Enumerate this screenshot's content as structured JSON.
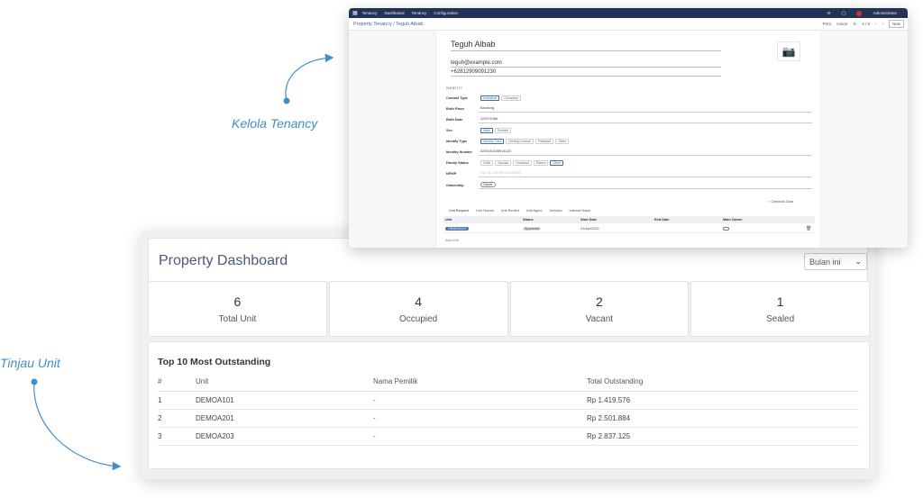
{
  "annotations": {
    "tenancy": "Kelola Tenancy",
    "unit": "Tinjau Unit"
  },
  "colors": {
    "accent": "#3f8fca",
    "navbar": "#24325a",
    "unit_badge": "#4d74a8"
  },
  "tenancy_window": {
    "navbar": {
      "apps_icon": "grid-icon",
      "items": [
        "Tenancy",
        "Dashboard",
        "Tenancy",
        "Configuration"
      ],
      "user": "Administrator"
    },
    "breadcrumb": "Property Tenancy / Teguh Albab",
    "toolbar": {
      "print": "Print",
      "action": "Action",
      "pager": "4 / 5",
      "new": "New"
    },
    "contact": {
      "name": "Teguh Albab",
      "email": "teguh@example.com",
      "phone": "+62812909091230"
    },
    "section_label": "IDENTITY",
    "fields": {
      "contact_type": {
        "label": "Contact Type",
        "options": [
          "Individual",
          "Company"
        ],
        "selected": "Individual"
      },
      "birth_place": {
        "label": "Birth Place",
        "value": "Bandung"
      },
      "birth_date": {
        "label": "Birth Date",
        "value": "22/02/1988"
      },
      "sex": {
        "label": "Sex",
        "options": [
          "Male",
          "Female"
        ],
        "selected": "Male"
      },
      "identity_type": {
        "label": "Identity Type",
        "options": [
          "Identity Card",
          "Driving License",
          "Passport",
          "Other"
        ],
        "selected": "Identity Card"
      },
      "identity_number": {
        "label": "Identity Number",
        "value": "3209182038914023"
      },
      "family_status": {
        "label": "Family Status",
        "options": [
          "Child",
          "Spouse",
          "Husband",
          "Parent",
          "Other"
        ],
        "selected": "Other"
      },
      "npwp": {
        "label": "NPWP",
        "placeholder": "e.g. 01.234.567.8-012.345"
      },
      "ownership": {
        "label": "Ownership",
        "value": "Owner"
      }
    },
    "optional_data": "Optional Data",
    "tabs": [
      "Unit Request",
      "Unit Owned",
      "Unit Rented",
      "Unit Agent",
      "Vehicles",
      "Internal Notes"
    ],
    "lines": {
      "headers": [
        "Unit",
        "Status",
        "Start Date",
        "End Date",
        "Main Owner"
      ],
      "rows": [
        {
          "unit": "DEMOA101",
          "status": "Approved",
          "start_date": "01/Apr/2022",
          "end_date": ""
        }
      ],
      "add_line": "Add Unit"
    }
  },
  "dashboard": {
    "title": "Property Dashboard",
    "period_select": "Bulan ini",
    "stats": [
      {
        "value": "6",
        "label": "Total Unit"
      },
      {
        "value": "4",
        "label": "Occupied"
      },
      {
        "value": "2",
        "label": "Vacant"
      },
      {
        "value": "1",
        "label": "Sealed"
      }
    ],
    "outstanding": {
      "title": "Top 10 Most Outstanding",
      "headers": [
        "#",
        "Unit",
        "Nama Pemilik",
        "Total Outstanding"
      ],
      "rows": [
        {
          "no": "1",
          "unit": "DEMOA101",
          "owner": "-",
          "total": "Rp 1.419.576"
        },
        {
          "no": "2",
          "unit": "DEMOA201",
          "owner": "-",
          "total": "Rp 2.501.884"
        },
        {
          "no": "3",
          "unit": "DEMOA203",
          "owner": "-",
          "total": "Rp 2.837.125"
        }
      ]
    }
  }
}
